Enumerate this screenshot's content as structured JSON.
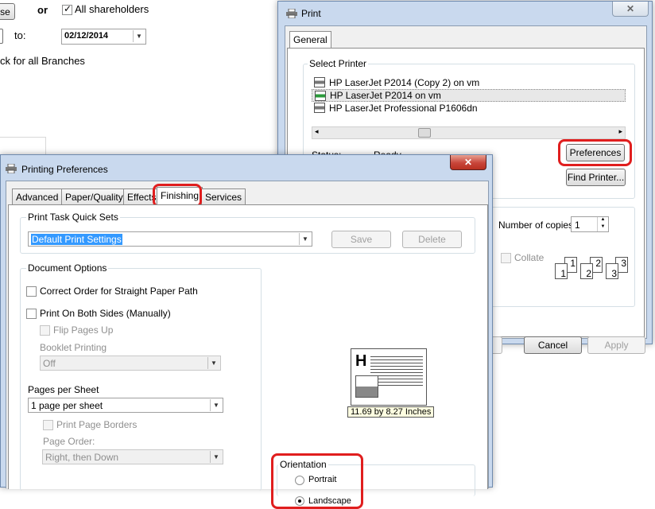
{
  "background": {
    "partial_button": "se",
    "or_label": "or",
    "all_shareholders_label": "All shareholders",
    "to_label": "to:",
    "to_date": "02/12/2014",
    "branches_label": "ck for all Branches"
  },
  "print_dialog": {
    "title": "Print",
    "tab_general": "General",
    "select_printer_label": "Select Printer",
    "printers": [
      "HP LaserJet P2014 (Copy 2) on vm",
      "HP LaserJet P2014 on vm",
      "HP LaserJet Professional P1606dn"
    ],
    "status_label": "Status:",
    "status_value": "Ready",
    "preferences_btn": "Preferences",
    "find_printer_btn": "Find Printer...",
    "copies_label": "Number of copies:",
    "copies_value": "1",
    "collate_label": "Collate",
    "cancel_btn": "Cancel",
    "apply_btn": "Apply",
    "collate_pages": [
      "1",
      "1",
      "2",
      "2",
      "3",
      "3"
    ]
  },
  "prefs_dialog": {
    "title": "Printing Preferences",
    "tabs": [
      "Advanced",
      "Paper/Quality",
      "Effects",
      "Finishing",
      "Services"
    ],
    "quicksets_label": "Print Task Quick Sets",
    "quickset_value": "Default Print Settings",
    "save_btn": "Save",
    "delete_btn": "Delete",
    "doc_options_label": "Document Options",
    "correct_order_label": "Correct Order for Straight Paper Path",
    "both_sides_label": "Print On Both Sides (Manually)",
    "flip_pages_label": "Flip Pages Up",
    "booklet_label": "Booklet Printing",
    "booklet_value": "Off",
    "pages_per_sheet_label": "Pages per Sheet",
    "pages_per_sheet_value": "1 page per sheet",
    "print_borders_label": "Print Page Borders",
    "page_order_label": "Page Order:",
    "page_order_value": "Right, then Down",
    "paper_size": "11.69 by 8.27 Inches",
    "orientation_label": "Orientation",
    "portrait_label": "Portrait",
    "landscape_label": "Landscape"
  },
  "colors": {
    "highlight": "#e01e1e",
    "selection": "#3399ff"
  }
}
